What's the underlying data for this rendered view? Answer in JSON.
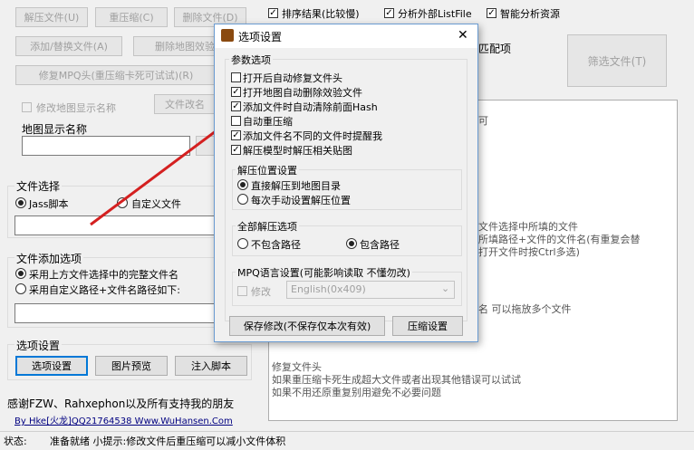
{
  "main": {
    "buttons": {
      "decompress": "解压文件(U)",
      "recompress": "重压缩(C)",
      "delete_file": "删除文件(D)",
      "add_replace": "添加/替换文件(A)",
      "delete_map_verify": "删除地图效验文",
      "fix_mpq": "修复MPQ头(重压缩卡死可试试)(R)",
      "file_rename": "文件改名",
      "filter_files": "筛选文件(T)",
      "options": "选项设置",
      "image_preview": "图片预览",
      "inject_script": "注入脚本"
    },
    "modify_map_name_label": "修改地图显示名称",
    "map_display_name_label": "地图显示名称",
    "top_checks": [
      {
        "label": "排序结果(比较慢)",
        "checked": true
      },
      {
        "label": "分析外部ListFile",
        "checked": true
      },
      {
        "label": "智能分析资源",
        "checked": true
      }
    ],
    "match_label": "匹配项",
    "file_select": {
      "title": "文件选择",
      "jass": "Jass脚本",
      "custom": "自定义文件"
    },
    "file_add": {
      "title": "文件添加选项",
      "opt1": "采用上方文件选择中的完整文件名",
      "opt2": "采用自定义路径+文件名路径如下:"
    },
    "options_group_title": "选项设置",
    "thanks": "感谢FZW、Rahxephon以及所有支持我的朋友",
    "credit_link": "By Hke[火龙]QQ21764538 Www.WuHansen.Com",
    "right_text": {
      "t1": "可",
      "t2": "文件选择中所填的文件",
      "t3": "所填路径+文件的文件名(有重复会替",
      "t4": "打开文件时按Ctrl多选)",
      "t5": "名 可以拖放多个文件",
      "t6": "修复文件头",
      "t7": "如果重压缩卡死生成超大文件或者出现其他错误可以试试",
      "t8": "如果不用还原重复别用避免不必要问题"
    },
    "status_label": "状态:",
    "status_text": "准备就绪 小提示:修改文件后重压缩可以减小文件体积"
  },
  "dialog": {
    "title": "选项设置",
    "close": "✕",
    "params_title": "参数选项",
    "options": [
      {
        "label": "打开后自动修复文件头",
        "checked": false
      },
      {
        "label": "打开地图自动删除效验文件",
        "checked": true
      },
      {
        "label": "添加文件时自动清除前面Hash",
        "checked": true
      },
      {
        "label": "自动重压缩",
        "checked": false
      },
      {
        "label": "添加文件名不同的文件时提醒我",
        "checked": true
      },
      {
        "label": "解压模型时解压相关贴图",
        "checked": true
      }
    ],
    "extract_group": "解压位置设置",
    "extract_opt1": "直接解压到地图目录",
    "extract_opt2": "每次手动设置解压位置",
    "all_extract_group": "全部解压选项",
    "no_path": "不包含路径",
    "with_path": "包含路径",
    "mpq_group": "MPQ语言设置(可能影响读取 不懂勿改)",
    "modify": "修改",
    "language": "English(0x409)",
    "save_button": "保存修改(不保存仅本次有效)",
    "compress_button": "压缩设置"
  },
  "colors": {
    "arrow": "#d42020",
    "link": "#000080",
    "dialog_border": "#6a9bd1"
  }
}
